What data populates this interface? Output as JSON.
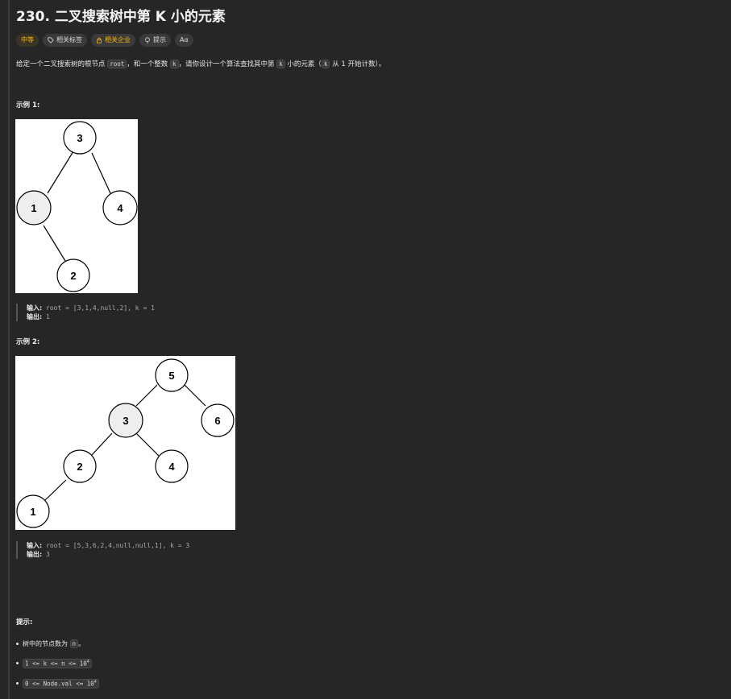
{
  "problem": {
    "title": "230. 二叉搜索树中第 K 小的元素",
    "tags": {
      "difficulty": "中等",
      "related_tags": "相关标签",
      "related_companies": "相关企业",
      "hint": "提示",
      "font": "Aα"
    },
    "description": {
      "p1": "给定一个二叉搜索树的根节点 ",
      "c1": "root",
      "p2": "，和一个整数 ",
      "c2": "k",
      "p3": "，请你设计一个算法查找其中第 ",
      "c3": "k",
      "p4": " 小的元素（",
      "c4": "k",
      "p5": " 从 1 开始计数）。"
    }
  },
  "examples": [
    {
      "heading": "示例 1:",
      "nodes": [
        "3",
        "1",
        "4",
        "2"
      ],
      "input_label": "输入:",
      "input_value": "root = [3,1,4,null,2], k = 1",
      "output_label": "输出:",
      "output_value": "1"
    },
    {
      "heading": "示例 2:",
      "nodes": [
        "5",
        "3",
        "6",
        "2",
        "4",
        "1"
      ],
      "input_label": "输入:",
      "input_value": "root = [5,3,6,2,4,null,null,1], k = 3",
      "output_label": "输出:",
      "output_value": "3"
    }
  ],
  "constraints": {
    "heading": "提示:",
    "item1_text": "树中的节点数为 ",
    "item1_code": "n",
    "item1_end": "。",
    "item2_code": "1 <= k <= n <= 10",
    "item2_sup": "4",
    "item3_code": "0 <= Node.val <= 10",
    "item3_sup": "4"
  },
  "colors": {
    "background": "#262626",
    "difficulty": "#ffb800",
    "highlight_node": "#eeeeee"
  }
}
